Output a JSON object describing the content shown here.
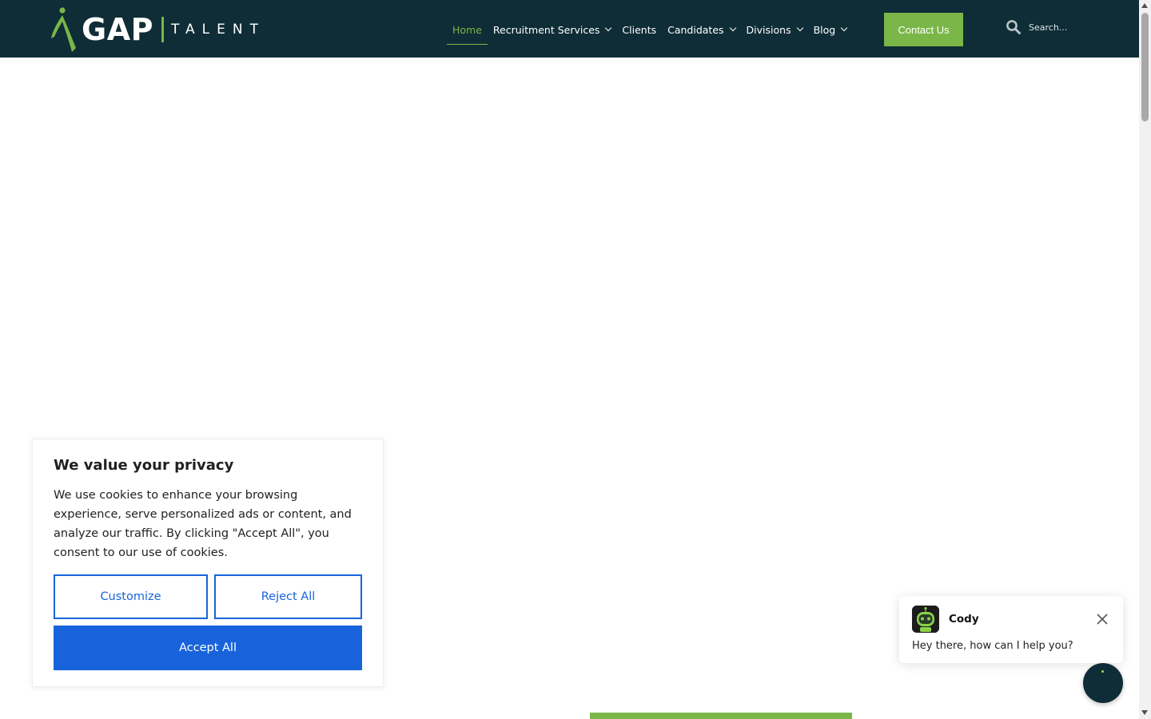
{
  "header": {
    "logo": {
      "primary": "GAP",
      "secondary": "TALENT"
    },
    "nav": [
      {
        "label": "Home",
        "active": true,
        "has_dropdown": false
      },
      {
        "label": "Recruitment Services",
        "active": false,
        "has_dropdown": true
      },
      {
        "label": "Clients",
        "active": false,
        "has_dropdown": false
      },
      {
        "label": "Candidates",
        "active": false,
        "has_dropdown": true
      },
      {
        "label": "Divisions",
        "active": false,
        "has_dropdown": true
      },
      {
        "label": "Blog",
        "active": false,
        "has_dropdown": true
      }
    ],
    "contact_label": "Contact Us",
    "search": {
      "placeholder": "Search...",
      "value": "",
      "icon": "search-icon"
    }
  },
  "cookie_banner": {
    "title": "We value your privacy",
    "text": "We use cookies to enhance your browsing experience, serve personalized ads or content, and analyze our traffic. By clicking \"Accept All\", you consent to our use of cookies.",
    "customize_label": "Customize",
    "reject_label": "Reject All",
    "accept_label": "Accept All"
  },
  "chat": {
    "bot_name": "Cody",
    "message": "Hey there, how can I help you?"
  },
  "colors": {
    "header_bg": "#0f2d36",
    "accent_green": "#7ab648",
    "cookie_blue": "#1863dc"
  }
}
